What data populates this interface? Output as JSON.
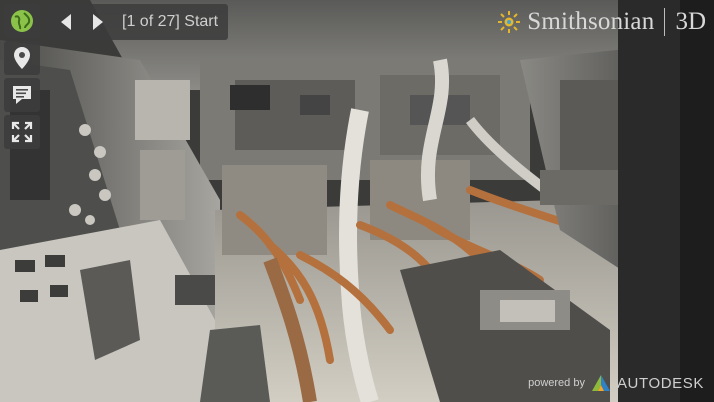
{
  "toolbar": {
    "buttons": [
      {
        "icon": "globe-icon",
        "color": "#8bc34a"
      },
      {
        "icon": "location-pin-icon"
      },
      {
        "icon": "annotations-icon"
      },
      {
        "icon": "fullscreen-icon"
      }
    ]
  },
  "tour": {
    "status": "[1 of 27] Start",
    "prev_icon": "prev-arrow-icon",
    "next_icon": "next-arrow-icon"
  },
  "brand": {
    "name": "Smithsonian",
    "suffix": "3D",
    "icon": "smithsonian-sun-icon"
  },
  "footer": {
    "powered_by": "powered by",
    "vendor": "AUTODESK",
    "icon": "autodesk-logo-icon"
  }
}
